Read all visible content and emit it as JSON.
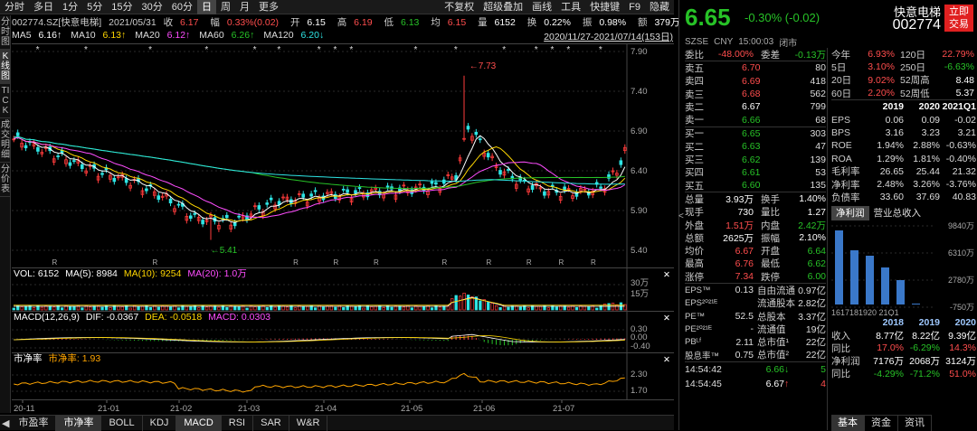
{
  "toolbar": {
    "items": [
      "分时",
      "多日",
      "1分",
      "5分",
      "15分",
      "30分",
      "60分",
      "日",
      "周",
      "月",
      "更多"
    ],
    "active": "日",
    "right_items": [
      "不复权",
      "超级叠加",
      "画线",
      "工具",
      "快捷键",
      "F9",
      "隐藏"
    ]
  },
  "leftbar": [
    "分时图",
    "K线图",
    "TICK",
    "成交明细",
    "分价表"
  ],
  "info": {
    "code": "002774.SZ[快意电梯]",
    "date": "2021/05/31",
    "close_label": "收",
    "close": "6.17",
    "amp_label": "幅",
    "amp": "0.33%(0.02)",
    "open_label": "开",
    "open": "6.15",
    "high_label": "高",
    "high": "6.19",
    "low_label": "低",
    "low": "6.13",
    "avg_label": "均",
    "avg": "6.15",
    "vol_label": "量",
    "vol": "6152",
    "turn_label": "换",
    "turn": "0.22%",
    "swing_label": "振",
    "swing": "0.98%",
    "amt_label": "额",
    "amt": "379万"
  },
  "ma": [
    {
      "label": "MA5",
      "value": "6.16↑",
      "color": "#ffffff"
    },
    {
      "label": "MA10",
      "value": "6.13↑",
      "color": "#ffd700"
    },
    {
      "label": "MA20",
      "value": "6.12↑",
      "color": "#ff4dff"
    },
    {
      "label": "MA60",
      "value": "6.26↑",
      "color": "#27c227"
    },
    {
      "label": "MA120",
      "value": "6.20↓",
      "color": "#2ee5e5"
    }
  ],
  "range": "2020/11/27-2021/07/14(153日)",
  "kline": {
    "yticks": [
      "7.90",
      "7.40",
      "6.90",
      "6.40",
      "5.90",
      "5.40"
    ],
    "high_mark": "7.73",
    "low_mark": "5.41",
    "xticks": [
      "20-11",
      "21-01",
      "21-02",
      "21-03",
      "21-04",
      "21-05",
      "21-06",
      "21-07"
    ]
  },
  "vol_panel": {
    "title": "VOL: 6152",
    "ma5": "MA(5): 8984",
    "ma10": "MA(10): 9254",
    "ma20": "MA(20): 1.0万",
    "yticks": [
      "30万",
      "15万"
    ]
  },
  "macd_panel": {
    "title": "MACD(12,26,9)",
    "dif": "DIF: -0.0367",
    "dea": "DEA: -0.0518",
    "macd": "MACD: 0.0303",
    "yticks": [
      "0.30",
      "0.00",
      "-0.40"
    ]
  },
  "pb_panel": {
    "title": "市净率",
    "value_label": "市净率: 1.93",
    "yticks": [
      "2.30",
      "1.70"
    ]
  },
  "bottom_tabs": [
    "市盈率",
    "市净率",
    "BOLL",
    "KDJ",
    "MACD",
    "RSI",
    "SAR",
    "W&R"
  ],
  "bottom_active": [
    "市净率",
    "MACD"
  ],
  "quote": {
    "price": "6.65",
    "change": "-0.30% (-0.02)",
    "name": "快意电梯",
    "code": "002774",
    "market": "SZSE",
    "currency": "CNY",
    "time": "15:00:03",
    "status": "闭市",
    "trade_btn": [
      "立即",
      "交易"
    ]
  },
  "orderbook_top": [
    {
      "lab": "委比",
      "pr": "-48.00%",
      "lab2": "委差",
      "v2": "-0.13万"
    }
  ],
  "asks": [
    {
      "lab": "卖五",
      "pr": "6.70",
      "vol": "80",
      "c": "red"
    },
    {
      "lab": "卖四",
      "pr": "6.69",
      "vol": "418",
      "c": "red"
    },
    {
      "lab": "卖三",
      "pr": "6.68",
      "vol": "562",
      "c": "red"
    },
    {
      "lab": "卖二",
      "pr": "6.67",
      "vol": "799",
      "c": "white"
    },
    {
      "lab": "卖一",
      "pr": "6.66",
      "vol": "68",
      "c": "green"
    }
  ],
  "bids": [
    {
      "lab": "买一",
      "pr": "6.65",
      "vol": "303",
      "c": "green"
    },
    {
      "lab": "买二",
      "pr": "6.63",
      "vol": "47",
      "c": "green"
    },
    {
      "lab": "买三",
      "pr": "6.62",
      "vol": "139",
      "c": "green"
    },
    {
      "lab": "买四",
      "pr": "6.61",
      "vol": "53",
      "c": "green"
    },
    {
      "lab": "买五",
      "pr": "6.60",
      "vol": "135",
      "c": "green"
    }
  ],
  "stats": [
    {
      "k": "总量",
      "v": "3.93万",
      "vc": "white",
      "k2": "换手",
      "v2": "1.40%",
      "v2c": "white"
    },
    {
      "k": "现手",
      "v": "730",
      "vc": "white",
      "k2": "量比",
      "v2": "1.27",
      "v2c": "white"
    },
    {
      "k": "外盘",
      "v": "1.51万",
      "vc": "red",
      "k2": "内盘",
      "v2": "2.42万",
      "v2c": "green"
    },
    {
      "k": "总额",
      "v": "2625万",
      "vc": "white",
      "k2": "振幅",
      "v2": "2.10%",
      "v2c": "white"
    },
    {
      "k": "均价",
      "v": "6.67",
      "vc": "red",
      "k2": "开盘",
      "v2": "6.64",
      "v2c": "green"
    },
    {
      "k": "最高",
      "v": "6.76",
      "vc": "red",
      "k2": "最低",
      "v2": "6.62",
      "v2c": "green"
    },
    {
      "k": "涨停",
      "v": "7.34",
      "vc": "red",
      "k2": "跌停",
      "v2": "6.00",
      "v2c": "green"
    }
  ],
  "fin": [
    {
      "k": "EPS™",
      "v": "0.13",
      "k2": "自由流通",
      "v2": "0.97亿"
    },
    {
      "k": "EPS²⁰²¹ᴱ",
      "v": "",
      "k2": "流通股本",
      "v2": "2.82亿"
    },
    {
      "k": "PE™",
      "v": "52.5",
      "k2": "总股本",
      "v2": "3.37亿"
    },
    {
      "k": "PE²⁰²¹ᴱ",
      "v": "-",
      "k2": "流通值",
      "v2": "19亿"
    },
    {
      "k": "PBᴸᶠ",
      "v": "2.11",
      "k2": "总市值¹",
      "v2": "22亿"
    },
    {
      "k": "股息率™",
      "v": "0.75",
      "k2": "总市值²",
      "v2": "22亿"
    }
  ],
  "ticks": [
    {
      "time": "14:54:42",
      "price": "6.66",
      "arrow": "↓",
      "vol": "5",
      "pc": "green",
      "vc": "green"
    },
    {
      "time": "14:54:45",
      "price": "6.67",
      "arrow": "↑",
      "vol": "4",
      "pc": "white",
      "vc": "red"
    }
  ],
  "perf": [
    {
      "k": "今年",
      "v": "6.93%",
      "vc": "red",
      "k2": "120日",
      "v2": "22.79%",
      "v2c": "red"
    },
    {
      "k": "5日",
      "v": "3.10%",
      "vc": "red",
      "k2": "250日",
      "v2": "-6.63%",
      "v2c": "green"
    },
    {
      "k": "20日",
      "v": "9.02%",
      "vc": "red",
      "k2": "52周高",
      "v2": "8.48",
      "v2c": "white"
    },
    {
      "k": "60日",
      "v": "2.20%",
      "vc": "red",
      "k2": "52周低",
      "v2": "5.37",
      "v2c": "white"
    }
  ],
  "ratio_header": [
    "2019",
    "2020",
    "2021Q1"
  ],
  "ratios": [
    {
      "k": "EPS",
      "v": [
        "0.06",
        "0.09",
        "-0.02"
      ]
    },
    {
      "k": "BPS",
      "v": [
        "3.16",
        "3.23",
        "3.21"
      ]
    },
    {
      "k": "ROE",
      "v": [
        "1.94%",
        "2.88%",
        "-0.63%"
      ]
    },
    {
      "k": "ROA",
      "v": [
        "1.29%",
        "1.81%",
        "-0.40%"
      ]
    },
    {
      "k": "毛利率",
      "v": [
        "26.65",
        "25.44",
        "21.32"
      ]
    },
    {
      "k": "净利率",
      "v": [
        "2.48%",
        "3.26%",
        "-3.76%"
      ]
    },
    {
      "k": "负债率",
      "v": [
        "33.60",
        "37.69",
        "40.83"
      ]
    }
  ],
  "fin_tabs": [
    "净利润",
    "营业总收入"
  ],
  "bar_chart": {
    "yticks": [
      "9840万",
      "6310万",
      "2780万",
      "-750万"
    ],
    "xlabels": "1617181920 21Q1",
    "bar_values": [
      82,
      60,
      54,
      41,
      27,
      1
    ]
  },
  "year_header": [
    "2018",
    "2019",
    "2020"
  ],
  "year_rows": [
    {
      "k": "收入",
      "v": [
        "8.77亿",
        "8.22亿",
        "9.39亿"
      ],
      "c": [
        "white",
        "white",
        "white"
      ]
    },
    {
      "k": "同比",
      "v": [
        "17.0%",
        "-6.29%",
        "14.3%"
      ],
      "c": [
        "red",
        "green",
        "red"
      ]
    },
    {
      "k": "净利润",
      "v": [
        "7176万",
        "2068万",
        "3124万"
      ],
      "c": [
        "white",
        "white",
        "white"
      ]
    },
    {
      "k": "同比",
      "v": [
        "-4.29%",
        "-71.2%",
        "51.0%"
      ],
      "c": [
        "green",
        "green",
        "red"
      ]
    }
  ],
  "right_bottom_tabs": [
    "基本",
    "资金",
    "资讯"
  ]
}
